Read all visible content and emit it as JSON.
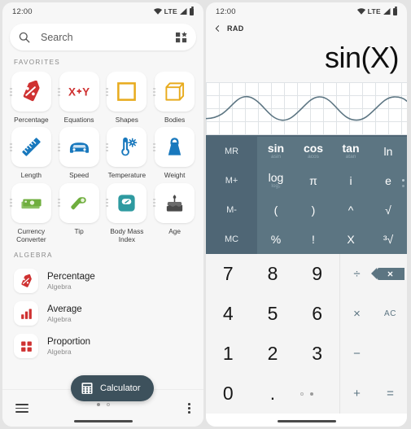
{
  "left": {
    "status": {
      "time": "12:00",
      "network": "LTE"
    },
    "search": {
      "placeholder": "Search",
      "search_icon": "search-icon",
      "grid_icon": "widgets-grid-icon"
    },
    "favorites_label": "FAVORITES",
    "favorites": [
      {
        "label": "Percentage",
        "icon": "percent-tag-icon",
        "color": "#cf3232"
      },
      {
        "label": "Equations",
        "icon": "x-plus-y-icon",
        "color": "#cf3232"
      },
      {
        "label": "Shapes",
        "icon": "square-outline-icon",
        "color": "#e8ab1d"
      },
      {
        "label": "Bodies",
        "icon": "cube-outline-icon",
        "color": "#e8ab1d"
      },
      {
        "label": "Length",
        "icon": "ruler-icon",
        "color": "#1878bd"
      },
      {
        "label": "Speed",
        "icon": "car-icon",
        "color": "#1878bd"
      },
      {
        "label": "Temperature",
        "icon": "thermometer-icon",
        "color": "#1878bd"
      },
      {
        "label": "Weight",
        "icon": "weight-icon",
        "color": "#1878bd"
      },
      {
        "label": "Currency Converter",
        "icon": "banknote-icon",
        "color": "#5aa councils"
      },
      {
        "label": "Tip",
        "icon": "hand-coin-icon",
        "color": "#6fae3e"
      },
      {
        "label": "Body Mass Index",
        "icon": "scale-icon",
        "color": "#2e9aa0"
      },
      {
        "label": "Age",
        "icon": "birthday-cake-icon",
        "color": "#4a4a4a"
      }
    ],
    "algebra_label": "ALGEBRA",
    "algebra_items": [
      {
        "title": "Percentage",
        "subtitle": "Algebra",
        "icon": "percent-tag-icon"
      },
      {
        "title": "Average",
        "subtitle": "Algebra",
        "icon": "bar-chart-icon"
      },
      {
        "title": "Proportion",
        "subtitle": "Algebra",
        "icon": "four-squares-icon"
      }
    ],
    "tooltip": {
      "label": "Calculator",
      "icon": "calculator-icon"
    },
    "bottom": {
      "menu_icon": "hamburger-menu-icon",
      "more_icon": "more-vertical-icon",
      "page_dots": 2,
      "active_dot": 0
    }
  },
  "right": {
    "status": {
      "time": "12:00",
      "network": "LTE"
    },
    "topbar": {
      "back_icon": "chevron-left-icon",
      "mode": "RAD"
    },
    "expression": "sin(X)",
    "graph": {
      "function": "sin(X)",
      "grid": true
    },
    "memory_keys": [
      "MR",
      "M+",
      "M-",
      "MC"
    ],
    "function_keys": [
      {
        "main": "sin",
        "sub": "asin",
        "bold": true
      },
      {
        "main": "cos",
        "sub": "acos",
        "bold": true
      },
      {
        "main": "tan",
        "sub": "atan",
        "bold": true
      },
      {
        "main": "ln",
        "sub": "",
        "bold": false
      },
      {
        "main": "log",
        "sub": "log₂",
        "bold": false
      },
      {
        "main": "π",
        "sub": "",
        "bold": false
      },
      {
        "main": "i",
        "sub": "",
        "bold": false
      },
      {
        "main": "e",
        "sub": "",
        "bold": false
      },
      {
        "main": "(",
        "sub": "",
        "bold": false
      },
      {
        "main": ")",
        "sub": "",
        "bold": false
      },
      {
        "main": "^",
        "sub": "",
        "bold": false
      },
      {
        "main": "√",
        "sub": "",
        "bold": false
      },
      {
        "main": "%",
        "sub": "",
        "bold": false
      },
      {
        "main": "!",
        "sub": "",
        "bold": false
      },
      {
        "main": "X",
        "sub": "",
        "bold": false
      },
      {
        "main": "³√",
        "sub": "",
        "bold": false
      }
    ],
    "number_keys": [
      "7",
      "8",
      "9",
      "4",
      "5",
      "6",
      "1",
      "2",
      "3",
      "0",
      ".",
      ""
    ],
    "operator_keys": [
      {
        "label": "÷",
        "name": "divide"
      },
      {
        "label": "",
        "name": "backspace"
      },
      {
        "label": "×",
        "name": "multiply"
      },
      {
        "label": "AC",
        "name": "all-clear"
      },
      {
        "label": "−",
        "name": "subtract"
      },
      {
        "label": "",
        "name": "blank"
      },
      {
        "label": "+",
        "name": "add"
      },
      {
        "label": "=",
        "name": "equals"
      }
    ],
    "bottom": {
      "page_dots": 2,
      "active_dot": 1
    }
  },
  "colors": {
    "func_pad": "#5c7582",
    "memory_col": "#4f6675",
    "tooltip_bg": "#3d515c",
    "graph_line": "#5c7582"
  }
}
